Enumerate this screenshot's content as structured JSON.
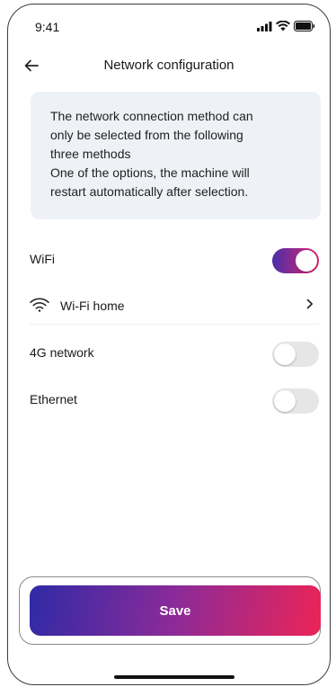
{
  "status_bar": {
    "time": "9:41",
    "icons": [
      "signal-icon",
      "wifi-icon",
      "battery-icon"
    ]
  },
  "header": {
    "back_icon": "arrow-left-icon",
    "title": "Network configuration"
  },
  "info": {
    "lines": [
      "The network connection method can",
      "only be selected from the following",
      "three methods",
      "One of the options, the machine will",
      "restart automatically after selection."
    ]
  },
  "options": {
    "wifi": {
      "label": "WiFi",
      "enabled": true
    },
    "wifi_network": {
      "name": "Wi-Fi home",
      "icon": "wifi-icon",
      "chevron": ">"
    },
    "cellular": {
      "label": "4G network",
      "enabled": false
    },
    "ethernet": {
      "label": "Ethernet",
      "enabled": false
    }
  },
  "save": {
    "label": "Save"
  },
  "colors": {
    "accent_start": "#4b2fa8",
    "accent_end": "#e2246f",
    "info_bg": "#eef2f6",
    "toggle_off": "#e6e6e6"
  }
}
